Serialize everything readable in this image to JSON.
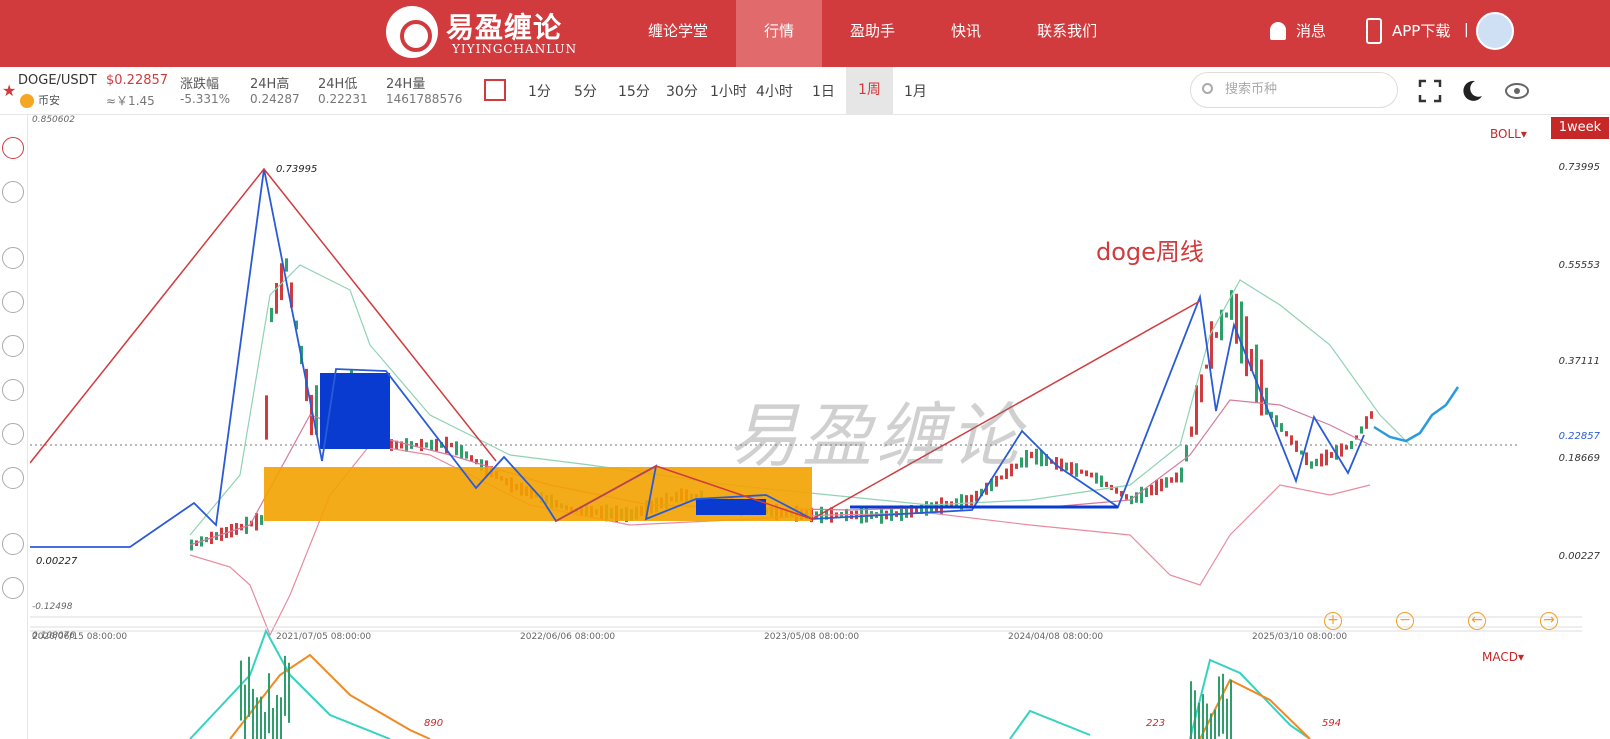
{
  "header": {
    "logo_title": "易盈缠论",
    "logo_sub": "YIYINGCHANLUN",
    "nav": [
      "缠论学堂",
      "行情",
      "盈助手",
      "快讯",
      "联系我们"
    ],
    "messages": "消息",
    "app_download": "APP下载",
    "separator": "|"
  },
  "ticker": {
    "pair": "DOGE/USDT",
    "price": "$0.22857",
    "cny": "≈￥1.45",
    "exchange": "币安",
    "change_label": "涨跌幅",
    "change_value": "-5.331%",
    "high_label": "24H高",
    "high_value": "0.24287",
    "low_label": "24H低",
    "low_value": "0.22231",
    "vol_label": "24H量",
    "vol_value": "1461788576"
  },
  "timeframes": [
    "1分",
    "5分",
    "15分",
    "30分",
    "1小时",
    "4小时",
    "1日",
    "1周",
    "1月"
  ],
  "active_timeframe": "1周",
  "search": {
    "placeholder": "搜索币种"
  },
  "chart": {
    "indicator": "BOLL▾",
    "period_badge": "1week",
    "macd_label": "MACD▾",
    "annotation": "doge周线",
    "watermark": "易盈缠论",
    "scale_top": "0.850602",
    "scale_bottom": "-0.12498",
    "macd_top": "0.108076",
    "peak_label": "0.73995",
    "low_label": "0.00227",
    "price_axis": [
      "0.73995",
      "0.55553",
      "0.37111",
      "0.22857",
      "0.18669",
      "0.00227"
    ],
    "dates": [
      "2020/06/15 08:00:00",
      "2021/07/05 08:00:00",
      "2022/06/06 08:00:00",
      "2023/05/08 08:00:00",
      "2024/04/08 08:00:00",
      "2025/03/10 08:00:00"
    ],
    "macd_values": [
      "890",
      "223",
      "594"
    ],
    "colors": {
      "up": "#2e9e6a",
      "down": "#d13b3e",
      "stroke_blue": "#2a5bd7",
      "zone_orange": "#f3a200",
      "zone_blue": "#0a3bd0"
    }
  }
}
